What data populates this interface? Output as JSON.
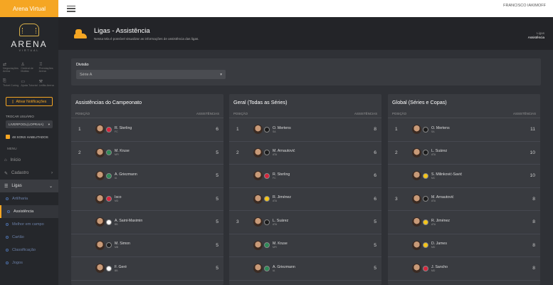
{
  "topbar": {
    "brand": "Arena Virtual",
    "user": "FRANCISCO IAKIMOFF"
  },
  "sidebar": {
    "logo_text": "ARENA",
    "logo_sub": "VIRTUAL",
    "quick_links": [
      {
        "label": "Negociações Arena",
        "icon": "swap-icon"
      },
      {
        "label": "Central de Multas",
        "icon": "bell-icon"
      },
      {
        "label": "Premiações Arena",
        "icon": "trophy-icon"
      },
      {
        "label": "Ticket Coring",
        "icon": "ticket-icon"
      },
      {
        "label": "Ajuda Tutorial",
        "icon": "help-icon"
      },
      {
        "label": "Leilão Arena",
        "icon": "gavel-icon"
      }
    ],
    "notif_button": "Ativar Notificações",
    "trocar_label": "TROCAR USUÁRIO",
    "selected_user": "LIVERPOOL(LOPRAIA)",
    "sons_label": "48 SONS HABILITADOS",
    "menu_label": "MENU",
    "menu": [
      {
        "label": "Início",
        "icon": "home-icon"
      },
      {
        "label": "Cadastro",
        "icon": "edit-icon"
      },
      {
        "label": "Ligas",
        "icon": "list-icon"
      }
    ],
    "submenu": [
      "Artilharia",
      "Assistência",
      "Melhor em campo",
      "Cartão",
      "Classificação",
      "Jogos"
    ]
  },
  "header": {
    "title": "Ligas - Assistência",
    "description": "Nessa tela é possível visualizar as informações de assistência das ligas.",
    "crumb1": "Ligas",
    "crumb2": "Assistência"
  },
  "filter": {
    "label": "Divisão",
    "value": "Série A"
  },
  "col_position": "POSIÇÃO",
  "col_assists": "ASSISTÊNCIAS",
  "cards": [
    {
      "title": "Assistências do Campeonato",
      "rows": [
        {
          "pos": "1",
          "name": "R. Sterling",
          "team": "FC",
          "value": "6",
          "club_color": "#d7263d"
        },
        {
          "pos": "2",
          "name": "M. Kruse",
          "team": "MFI",
          "value": "5",
          "club_color": "#2e8b57"
        },
        {
          "pos": "",
          "name": "A. Griezmann",
          "team": "IA",
          "value": "5",
          "club_color": "#2e8b57"
        },
        {
          "pos": "",
          "name": "Isco",
          "team": "MD",
          "value": "5",
          "club_color": "#d7263d"
        },
        {
          "pos": "",
          "name": "A. Saint-Maximin",
          "team": "BB",
          "value": "5",
          "club_color": "#ffffff"
        },
        {
          "pos": "",
          "name": "M. Simon",
          "team": "MB",
          "value": "5",
          "club_color": "#222222"
        },
        {
          "pos": "",
          "name": "F. Geré",
          "team": "BB",
          "value": "5",
          "club_color": "#ffffff"
        }
      ]
    },
    {
      "title": "Geral (Todas as Séries)",
      "rows": [
        {
          "pos": "1",
          "name": "O. Mertens",
          "team": "SA",
          "value": "8",
          "club_color": "#1c1c1c"
        },
        {
          "pos": "2",
          "name": "M. Arnautović",
          "team": "ATA",
          "value": "6",
          "club_color": "#1c1c1c"
        },
        {
          "pos": "",
          "name": "R. Sterling",
          "team": "FC",
          "value": "6",
          "club_color": "#d7263d"
        },
        {
          "pos": "",
          "name": "R. Jiménez",
          "team": "ATA",
          "value": "6",
          "club_color": "#f5c518"
        },
        {
          "pos": "3",
          "name": "L. Suárez",
          "team": "ATA",
          "value": "5",
          "club_color": "#1c1c1c"
        },
        {
          "pos": "",
          "name": "M. Kruse",
          "team": "MFI",
          "value": "5",
          "club_color": "#2e8b57"
        },
        {
          "pos": "",
          "name": "A. Griezmann",
          "team": "IA",
          "value": "5",
          "club_color": "#2e8b57"
        }
      ]
    },
    {
      "title": "Global (Séries e Copas)",
      "rows": [
        {
          "pos": "1",
          "name": "O. Mertens",
          "team": "SA",
          "value": "11",
          "club_color": "#1c1c1c"
        },
        {
          "pos": "2",
          "name": "L. Suárez",
          "team": "ATA",
          "value": "10",
          "club_color": "#1c1c1c"
        },
        {
          "pos": "",
          "name": "S. Milinković-Savić",
          "team": "MC",
          "value": "10",
          "club_color": "#f5c518"
        },
        {
          "pos": "3",
          "name": "M. Arnautović",
          "team": "ATA",
          "value": "8",
          "club_color": "#1c1c1c"
        },
        {
          "pos": "",
          "name": "R. Jiménez",
          "team": "ATA",
          "value": "8",
          "club_color": "#f5c518"
        },
        {
          "pos": "",
          "name": "D. James",
          "team": "MD",
          "value": "8",
          "club_color": "#f5c518"
        },
        {
          "pos": "",
          "name": "J. Sancho",
          "team": "MD",
          "value": "8",
          "club_color": "#d7263d"
        }
      ]
    }
  ]
}
